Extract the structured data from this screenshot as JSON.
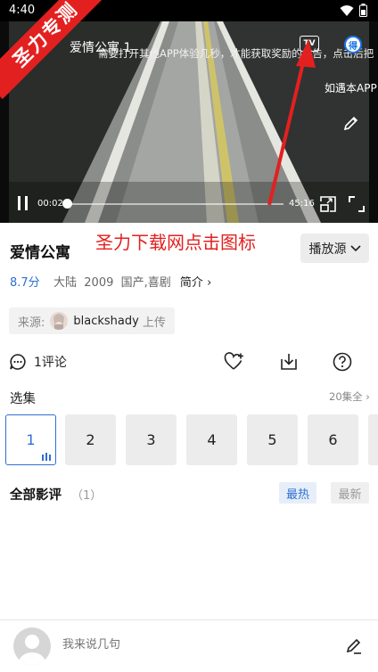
{
  "status_bar": {
    "time": "4:40"
  },
  "player": {
    "title": "爱情公寓 1",
    "ad_notice": "需要打开其他APP体验几秒，才能获取奖励的广告，点击后把",
    "tv_label": "TV",
    "reward_badge": "得",
    "reward_text": "如遇本APP",
    "current_time": "00:02",
    "total_time": "45:16",
    "progress_fraction": 0.001
  },
  "watermark": "圣力专测",
  "annotation": "圣力下载网点击图标",
  "show": {
    "title": "爱情公寓",
    "source_button": "播放源",
    "rating": "8.7分",
    "region": "大陆",
    "year": "2009",
    "genres": "国产,喜剧",
    "intro_link": "简介"
  },
  "uploader": {
    "prefix": "来源:",
    "name": "blackshady",
    "suffix": "上传"
  },
  "actions": {
    "comment_count": "1评论"
  },
  "episodes": {
    "label": "选集",
    "all_link": "20集全",
    "items": [
      "1",
      "2",
      "3",
      "4",
      "5",
      "6"
    ]
  },
  "reviews": {
    "title": "全部影评",
    "count": "（1）",
    "sort_hot": "最热",
    "sort_new": "最新"
  },
  "comment_bar": {
    "placeholder": "我来说几句"
  },
  "colors": {
    "accent": "#2f6fd1",
    "annotation": "#e32020"
  }
}
